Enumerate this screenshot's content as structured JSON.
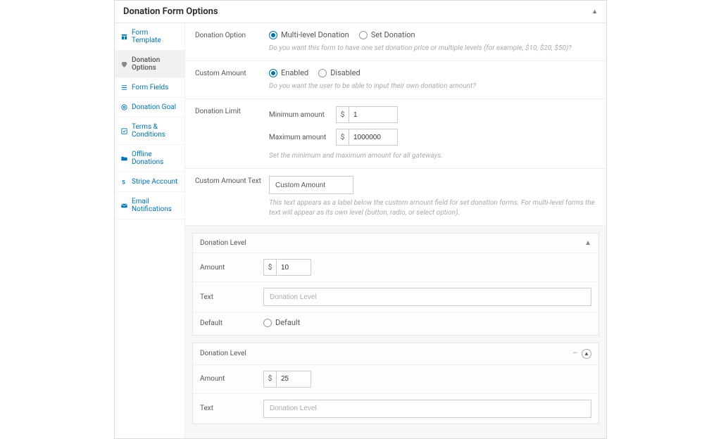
{
  "panel": {
    "title": "Donation Form Options"
  },
  "sidebar": {
    "items": [
      {
        "label": "Form Template"
      },
      {
        "label": "Donation Options"
      },
      {
        "label": "Form Fields"
      },
      {
        "label": "Donation Goal"
      },
      {
        "label": "Terms & Conditions"
      },
      {
        "label": "Offline Donations"
      },
      {
        "label": "Stripe Account"
      },
      {
        "label": "Email Notifications"
      }
    ]
  },
  "donation_option": {
    "label": "Donation Option",
    "opt_multi": "Multi-level Donation",
    "opt_set": "Set Donation",
    "help": "Do you want this form to have one set donation price or multiple levels (for example, $10, $20, $50)?"
  },
  "custom_amount": {
    "label": "Custom Amount",
    "opt_enabled": "Enabled",
    "opt_disabled": "Disabled",
    "help": "Do you want the user to be able to input their own donation amount?"
  },
  "donation_limit": {
    "label": "Donation Limit",
    "min_label": "Minimum amount",
    "max_label": "Maximum amount",
    "currency": "$",
    "min_value": "1",
    "max_value": "1000000",
    "help": "Set the minimum and maximum amount for all gateways."
  },
  "custom_amount_text": {
    "label": "Custom Amount Text",
    "value": "Custom Amount",
    "help": "This text appears as a label below the custom amount field for set donation forms. For multi-level forms the text will appear as its own level (button, radio, or select option)."
  },
  "level_common": {
    "title": "Donation Level",
    "amount_label": "Amount",
    "text_label": "Text",
    "default_label": "Default",
    "default_radio": "Default",
    "currency": "$",
    "text_placeholder": "Donation Level",
    "remove": "–"
  },
  "levels": [
    {
      "amount": "10"
    },
    {
      "amount": "25"
    }
  ]
}
